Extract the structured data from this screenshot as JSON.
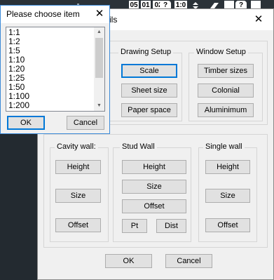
{
  "toolbar": {
    "items": [
      "05",
      "01",
      "02",
      "?",
      "1:0",
      "?"
    ]
  },
  "main_dialog": {
    "title": "ils",
    "close_glyph": "✕",
    "drawing_setup": {
      "label": "Drawing Setup",
      "buttons": [
        "Scale",
        "Sheet size",
        "Paper space"
      ]
    },
    "window_setup": {
      "label": "Window Setup",
      "buttons": [
        "Timber sizes",
        "Colonial",
        "Aluminimum"
      ]
    },
    "cavity_wall": {
      "label": "Cavity wall:",
      "buttons": [
        "Height",
        "Size",
        "Offset"
      ]
    },
    "stud_wall": {
      "label": "Stud Wall",
      "buttons": [
        "Height",
        "Size",
        "Offset",
        "Pt",
        "Dist"
      ]
    },
    "single_wall": {
      "label": "Single wall",
      "buttons": [
        "Height",
        "Size",
        "Offset"
      ]
    },
    "ok_label": "OK",
    "cancel_label": "Cancel"
  },
  "list_dialog": {
    "title": "Please choose item",
    "close_glyph": "✕",
    "items": [
      "1:1",
      "1:2",
      "1:5",
      "1:10",
      "1:20",
      "1:25",
      "1:50",
      "1:100",
      "1:200"
    ],
    "scroll_up": "▲",
    "scroll_down": "▼",
    "ok_label": "OK",
    "cancel_label": "Cancel"
  }
}
